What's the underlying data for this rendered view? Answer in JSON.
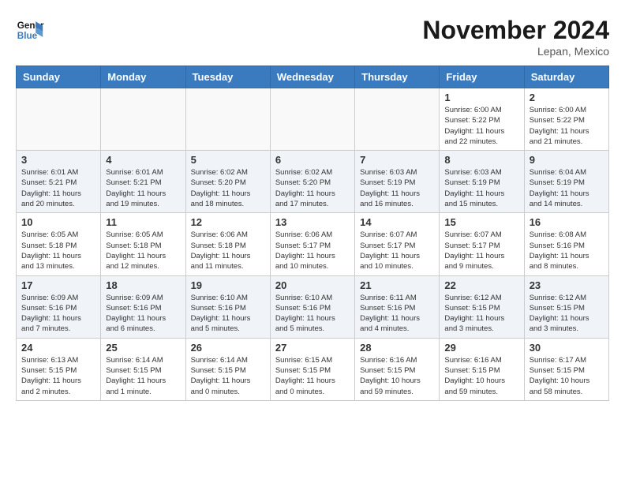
{
  "header": {
    "logo_line1": "General",
    "logo_line2": "Blue",
    "month": "November 2024",
    "location": "Lepan, Mexico"
  },
  "weekdays": [
    "Sunday",
    "Monday",
    "Tuesday",
    "Wednesday",
    "Thursday",
    "Friday",
    "Saturday"
  ],
  "rows": [
    {
      "cells": [
        {
          "day": "",
          "info": ""
        },
        {
          "day": "",
          "info": ""
        },
        {
          "day": "",
          "info": ""
        },
        {
          "day": "",
          "info": ""
        },
        {
          "day": "",
          "info": ""
        },
        {
          "day": "1",
          "info": "Sunrise: 6:00 AM\nSunset: 5:22 PM\nDaylight: 11 hours\nand 22 minutes."
        },
        {
          "day": "2",
          "info": "Sunrise: 6:00 AM\nSunset: 5:22 PM\nDaylight: 11 hours\nand 21 minutes."
        }
      ]
    },
    {
      "cells": [
        {
          "day": "3",
          "info": "Sunrise: 6:01 AM\nSunset: 5:21 PM\nDaylight: 11 hours\nand 20 minutes."
        },
        {
          "day": "4",
          "info": "Sunrise: 6:01 AM\nSunset: 5:21 PM\nDaylight: 11 hours\nand 19 minutes."
        },
        {
          "day": "5",
          "info": "Sunrise: 6:02 AM\nSunset: 5:20 PM\nDaylight: 11 hours\nand 18 minutes."
        },
        {
          "day": "6",
          "info": "Sunrise: 6:02 AM\nSunset: 5:20 PM\nDaylight: 11 hours\nand 17 minutes."
        },
        {
          "day": "7",
          "info": "Sunrise: 6:03 AM\nSunset: 5:19 PM\nDaylight: 11 hours\nand 16 minutes."
        },
        {
          "day": "8",
          "info": "Sunrise: 6:03 AM\nSunset: 5:19 PM\nDaylight: 11 hours\nand 15 minutes."
        },
        {
          "day": "9",
          "info": "Sunrise: 6:04 AM\nSunset: 5:19 PM\nDaylight: 11 hours\nand 14 minutes."
        }
      ]
    },
    {
      "cells": [
        {
          "day": "10",
          "info": "Sunrise: 6:05 AM\nSunset: 5:18 PM\nDaylight: 11 hours\nand 13 minutes."
        },
        {
          "day": "11",
          "info": "Sunrise: 6:05 AM\nSunset: 5:18 PM\nDaylight: 11 hours\nand 12 minutes."
        },
        {
          "day": "12",
          "info": "Sunrise: 6:06 AM\nSunset: 5:18 PM\nDaylight: 11 hours\nand 11 minutes."
        },
        {
          "day": "13",
          "info": "Sunrise: 6:06 AM\nSunset: 5:17 PM\nDaylight: 11 hours\nand 10 minutes."
        },
        {
          "day": "14",
          "info": "Sunrise: 6:07 AM\nSunset: 5:17 PM\nDaylight: 11 hours\nand 10 minutes."
        },
        {
          "day": "15",
          "info": "Sunrise: 6:07 AM\nSunset: 5:17 PM\nDaylight: 11 hours\nand 9 minutes."
        },
        {
          "day": "16",
          "info": "Sunrise: 6:08 AM\nSunset: 5:16 PM\nDaylight: 11 hours\nand 8 minutes."
        }
      ]
    },
    {
      "cells": [
        {
          "day": "17",
          "info": "Sunrise: 6:09 AM\nSunset: 5:16 PM\nDaylight: 11 hours\nand 7 minutes."
        },
        {
          "day": "18",
          "info": "Sunrise: 6:09 AM\nSunset: 5:16 PM\nDaylight: 11 hours\nand 6 minutes."
        },
        {
          "day": "19",
          "info": "Sunrise: 6:10 AM\nSunset: 5:16 PM\nDaylight: 11 hours\nand 5 minutes."
        },
        {
          "day": "20",
          "info": "Sunrise: 6:10 AM\nSunset: 5:16 PM\nDaylight: 11 hours\nand 5 minutes."
        },
        {
          "day": "21",
          "info": "Sunrise: 6:11 AM\nSunset: 5:16 PM\nDaylight: 11 hours\nand 4 minutes."
        },
        {
          "day": "22",
          "info": "Sunrise: 6:12 AM\nSunset: 5:15 PM\nDaylight: 11 hours\nand 3 minutes."
        },
        {
          "day": "23",
          "info": "Sunrise: 6:12 AM\nSunset: 5:15 PM\nDaylight: 11 hours\nand 3 minutes."
        }
      ]
    },
    {
      "cells": [
        {
          "day": "24",
          "info": "Sunrise: 6:13 AM\nSunset: 5:15 PM\nDaylight: 11 hours\nand 2 minutes."
        },
        {
          "day": "25",
          "info": "Sunrise: 6:14 AM\nSunset: 5:15 PM\nDaylight: 11 hours\nand 1 minute."
        },
        {
          "day": "26",
          "info": "Sunrise: 6:14 AM\nSunset: 5:15 PM\nDaylight: 11 hours\nand 0 minutes."
        },
        {
          "day": "27",
          "info": "Sunrise: 6:15 AM\nSunset: 5:15 PM\nDaylight: 11 hours\nand 0 minutes."
        },
        {
          "day": "28",
          "info": "Sunrise: 6:16 AM\nSunset: 5:15 PM\nDaylight: 10 hours\nand 59 minutes."
        },
        {
          "day": "29",
          "info": "Sunrise: 6:16 AM\nSunset: 5:15 PM\nDaylight: 10 hours\nand 59 minutes."
        },
        {
          "day": "30",
          "info": "Sunrise: 6:17 AM\nSunset: 5:15 PM\nDaylight: 10 hours\nand 58 minutes."
        }
      ]
    }
  ]
}
